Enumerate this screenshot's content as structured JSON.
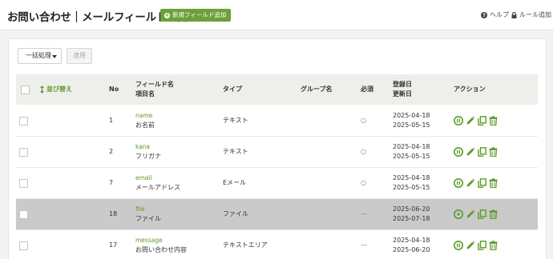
{
  "header": {
    "title": "お問い合わせ｜メールフィールド一覧",
    "add_button": "新規フィールド追加",
    "help": "ヘルプ",
    "rules": "ルール追加"
  },
  "toolbar": {
    "bulk_action": "一括処理",
    "apply": "適用"
  },
  "table": {
    "sort_label": "並び替え",
    "columns": {
      "no": "No",
      "field_name": "フィールド名",
      "item_name": "項目名",
      "type": "タイプ",
      "group": "グループ名",
      "required": "必須",
      "created": "登録日",
      "modified": "更新日",
      "actions": "アクション"
    },
    "rows": [
      {
        "no": "1",
        "field": "name",
        "item": "お名前",
        "type": "テキスト",
        "group": "",
        "required": "○",
        "created": "2025-04-18",
        "modified": "2025-05-15",
        "status": "active"
      },
      {
        "no": "2",
        "field": "kana",
        "item": "フリガナ",
        "type": "テキスト",
        "group": "",
        "required": "○",
        "created": "2025-04-18",
        "modified": "2025-05-15",
        "status": "active"
      },
      {
        "no": "7",
        "field": "email",
        "item": "メールアドレス",
        "type": "Eメール",
        "group": "",
        "required": "○",
        "created": "2025-04-18",
        "modified": "2025-05-15",
        "status": "active"
      },
      {
        "no": "18",
        "field": "file",
        "item": "ファイル",
        "type": "ファイル",
        "group": "",
        "required": "—",
        "created": "2025-06-20",
        "modified": "2025-07-18",
        "status": "inactive"
      },
      {
        "no": "17",
        "field": "message",
        "item": "お問い合わせ内容",
        "type": "テキストエリア",
        "group": "",
        "required": "—",
        "created": "2025-04-18",
        "modified": "2025-06-20",
        "status": "active"
      }
    ]
  },
  "colors": {
    "accent": "#6ba03b",
    "link": "#5e9a2c",
    "disabled_row": "#cacaca"
  }
}
